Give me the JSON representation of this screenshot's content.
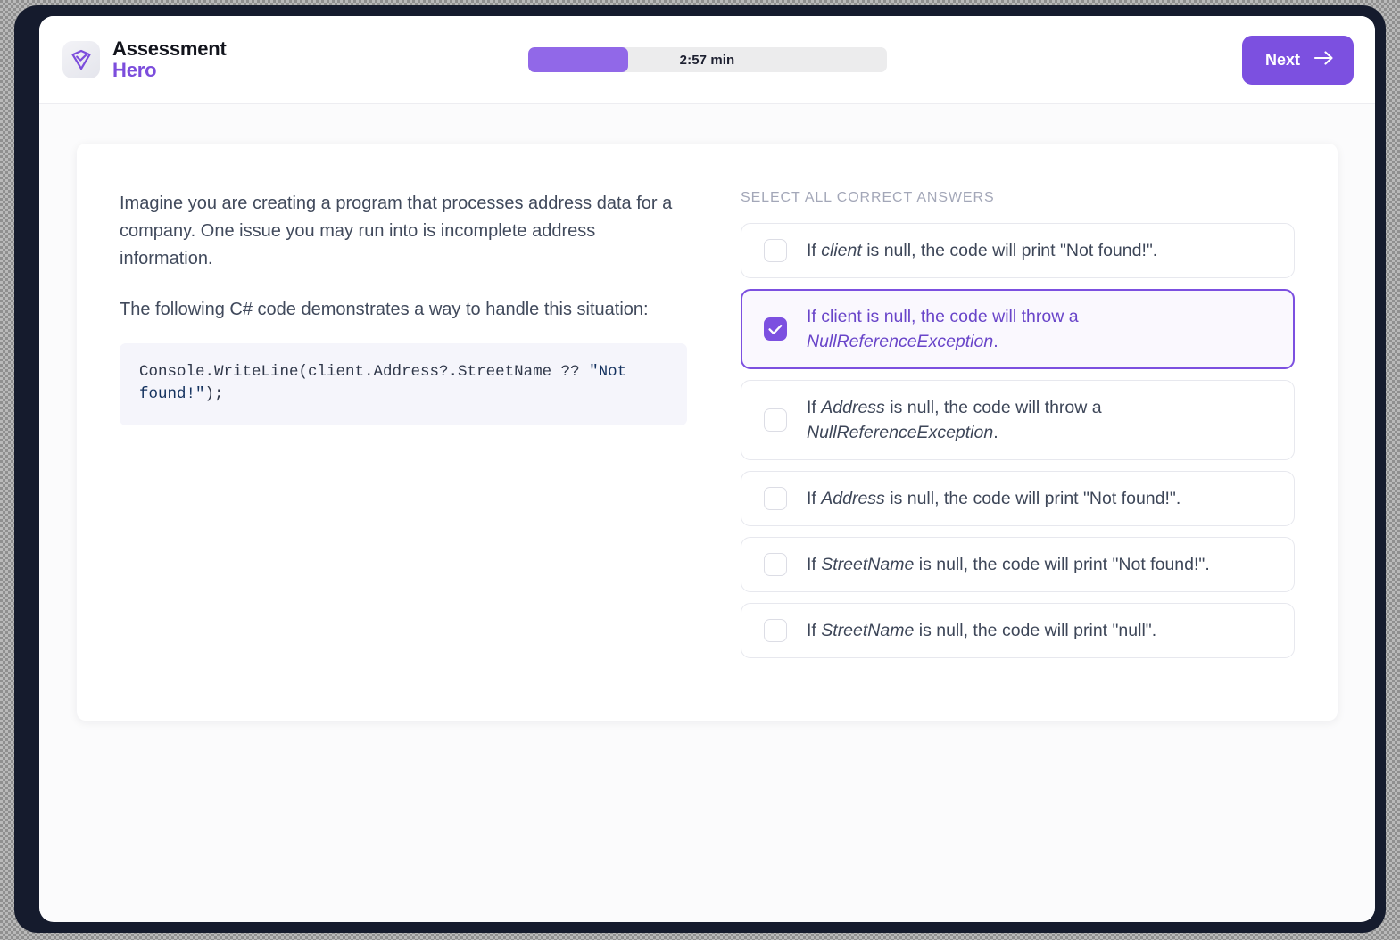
{
  "brand": {
    "line1": "Assessment",
    "line2": "Hero",
    "logo_icon": "shield-check-icon",
    "accent_color": "#7c4ddc"
  },
  "header": {
    "timer_label": "2:57 min",
    "timer_progress_percent": 28,
    "timer_fill_color": "#9168e8",
    "timer_track_color": "#ececed",
    "next_label": "Next",
    "next_icon": "arrow-right-icon",
    "next_color": "#7c50e0"
  },
  "question": {
    "paragraphs": [
      "Imagine you are creating a program that processes address data for a company. One issue you may run into is incomplete address information.",
      "The following C# code demonstrates a way to handle this situation:"
    ],
    "code": {
      "part1": "Console.WriteLine(client.Address?.StreetName ?? ",
      "string_literal": "\"Not found!\"",
      "part2": ");"
    }
  },
  "answers": {
    "title": "SELECT ALL CORRECT ANSWERS",
    "options": [
      {
        "id": "option-1",
        "selected": false,
        "prefix": "If ",
        "emphasis": "client",
        "suffix": " is null, the code will print \"Not found!\".",
        "tail_emphasis": "",
        "tail_suffix": ""
      },
      {
        "id": "option-2",
        "selected": true,
        "prefix": "If client is null, the code will throw a ",
        "emphasis": "NullReferenceException",
        "suffix": ".",
        "tail_emphasis": "",
        "tail_suffix": ""
      },
      {
        "id": "option-3",
        "selected": false,
        "prefix": "If ",
        "emphasis": "Address",
        "suffix": " is null, the code will throw a ",
        "tail_emphasis": "NullReferenceException",
        "tail_suffix": "."
      },
      {
        "id": "option-4",
        "selected": false,
        "prefix": "If ",
        "emphasis": "Address",
        "suffix": " is null, the code will print \"Not found!\".",
        "tail_emphasis": "",
        "tail_suffix": ""
      },
      {
        "id": "option-5",
        "selected": false,
        "prefix": "If ",
        "emphasis": "StreetName",
        "suffix": " is null, the code will print \"Not found!\".",
        "tail_emphasis": "",
        "tail_suffix": ""
      },
      {
        "id": "option-6",
        "selected": false,
        "prefix": "If ",
        "emphasis": "StreetName",
        "suffix": " is null, the code will print \"null\".",
        "tail_emphasis": "",
        "tail_suffix": ""
      }
    ]
  }
}
